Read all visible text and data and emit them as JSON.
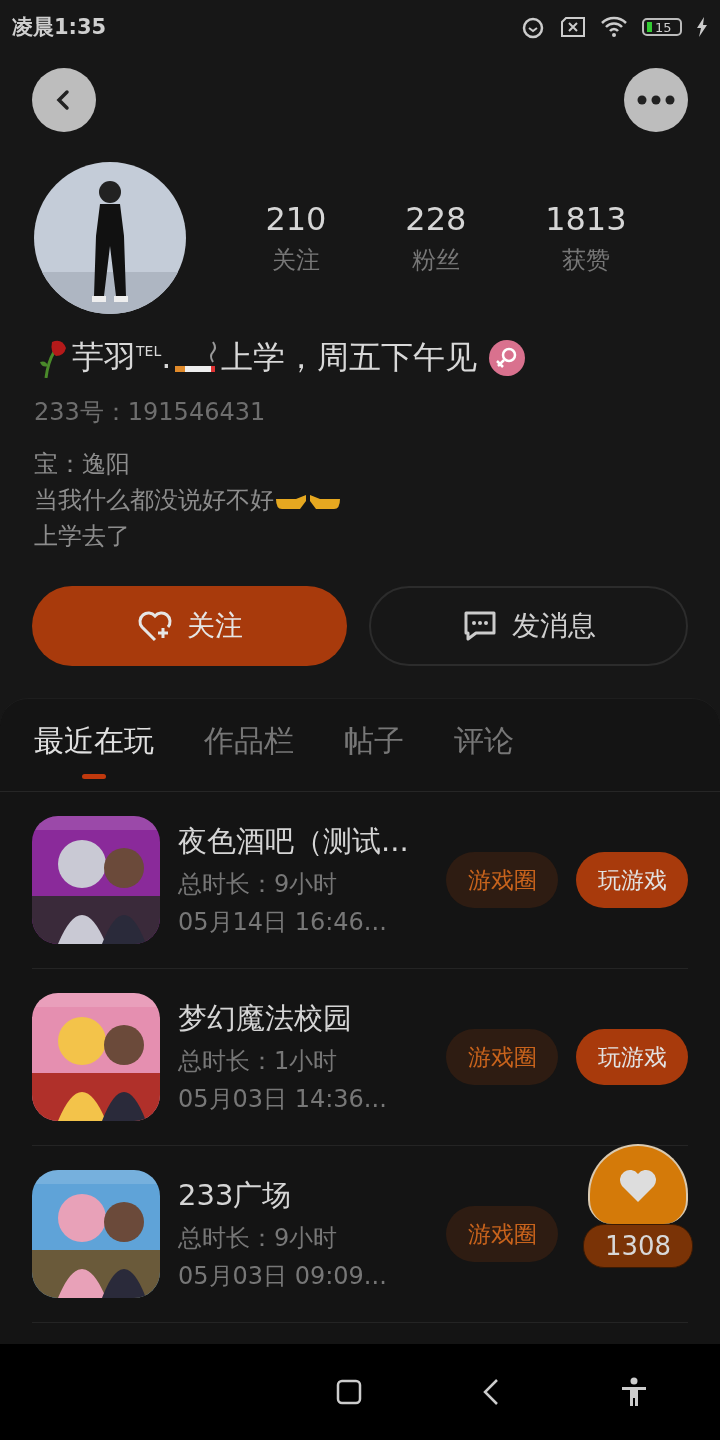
{
  "status_bar": {
    "time": "凌晨1:35",
    "battery": "15"
  },
  "profile": {
    "stats": [
      {
        "value": "210",
        "label": "关注"
      },
      {
        "value": "228",
        "label": "粉丝"
      },
      {
        "value": "1813",
        "label": "获赞"
      }
    ],
    "name_parts": [
      "芋羽$^{TEL}$.",
      "上学，周五下午见"
    ],
    "id": "233号：191546431",
    "bio": [
      "宝：逸阳",
      "当我什么都没说好不好",
      "上学去了"
    ]
  },
  "actions": [
    {
      "label": "关注",
      "kind": "primary"
    },
    {
      "label": "发消息",
      "kind": "secondary"
    }
  ],
  "tabs": [
    {
      "label": "最近在玩",
      "selected": true
    },
    {
      "label": "作品栏",
      "selected": false
    },
    {
      "label": "帖子",
      "selected": false
    },
    {
      "label": "评论",
      "selected": false
    }
  ],
  "games": [
    {
      "title": "夜色酒吧（测试...",
      "duration": "总时长：9小时",
      "time": "05月14日 16:46...",
      "circle": "游戏圈",
      "play": "玩游戏"
    },
    {
      "title": "梦幻魔法校园",
      "duration": "总时长：1小时",
      "time": "05月03日 14:36...",
      "circle": "游戏圈",
      "play": "玩游戏"
    },
    {
      "title": "233广场",
      "duration": "总时长：9小时",
      "time": "05月03日 09:09...",
      "circle": "游戏圈"
    }
  ],
  "like_float": {
    "count": "1308"
  }
}
